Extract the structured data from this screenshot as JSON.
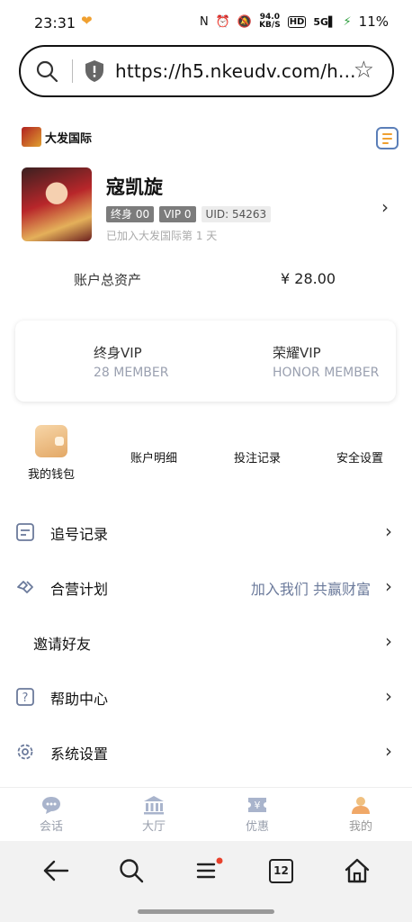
{
  "status_bar": {
    "time": "23:31",
    "net_speed_value": "94.0",
    "net_speed_unit": "KB/S",
    "hd": "HD",
    "signal": "5G",
    "battery": "11%"
  },
  "browser": {
    "url": "https://h5.nkeudv.com/h...",
    "tab_count": "12"
  },
  "header": {
    "brand_name": "大发国际"
  },
  "profile": {
    "username": "寇凯旋",
    "badge_lifetime": "终身 00",
    "badge_vip": "VIP 0",
    "uid": "UID: 54263",
    "joined": "已加入大发国际第 1 天"
  },
  "assets": {
    "label": "账户总资产",
    "value": "¥ 28.00"
  },
  "vip_card": {
    "lifetime_title": "终身VIP",
    "lifetime_sub": "28 MEMBER",
    "honor_title": "荣耀VIP",
    "honor_sub": "HONOR MEMBER"
  },
  "quick_actions": {
    "wallet": "我的钱包",
    "account_detail": "账户明细",
    "bet_record": "投注记录",
    "security": "安全设置"
  },
  "menu": {
    "items": [
      {
        "label": "追号记录",
        "extra": ""
      },
      {
        "label": "合营计划",
        "extra": "加入我们 共赢财富"
      },
      {
        "label": "邀请好友",
        "extra": ""
      },
      {
        "label": "帮助中心",
        "extra": ""
      },
      {
        "label": "系统设置",
        "extra": ""
      }
    ]
  },
  "tabbar": {
    "chat": "会话",
    "hall": "大厅",
    "promo": "优惠",
    "mine": "我的"
  },
  "colors": {
    "accent_orange": "#f0a030",
    "link_blue": "#6b7a9b",
    "muted": "#9aa0b0"
  }
}
